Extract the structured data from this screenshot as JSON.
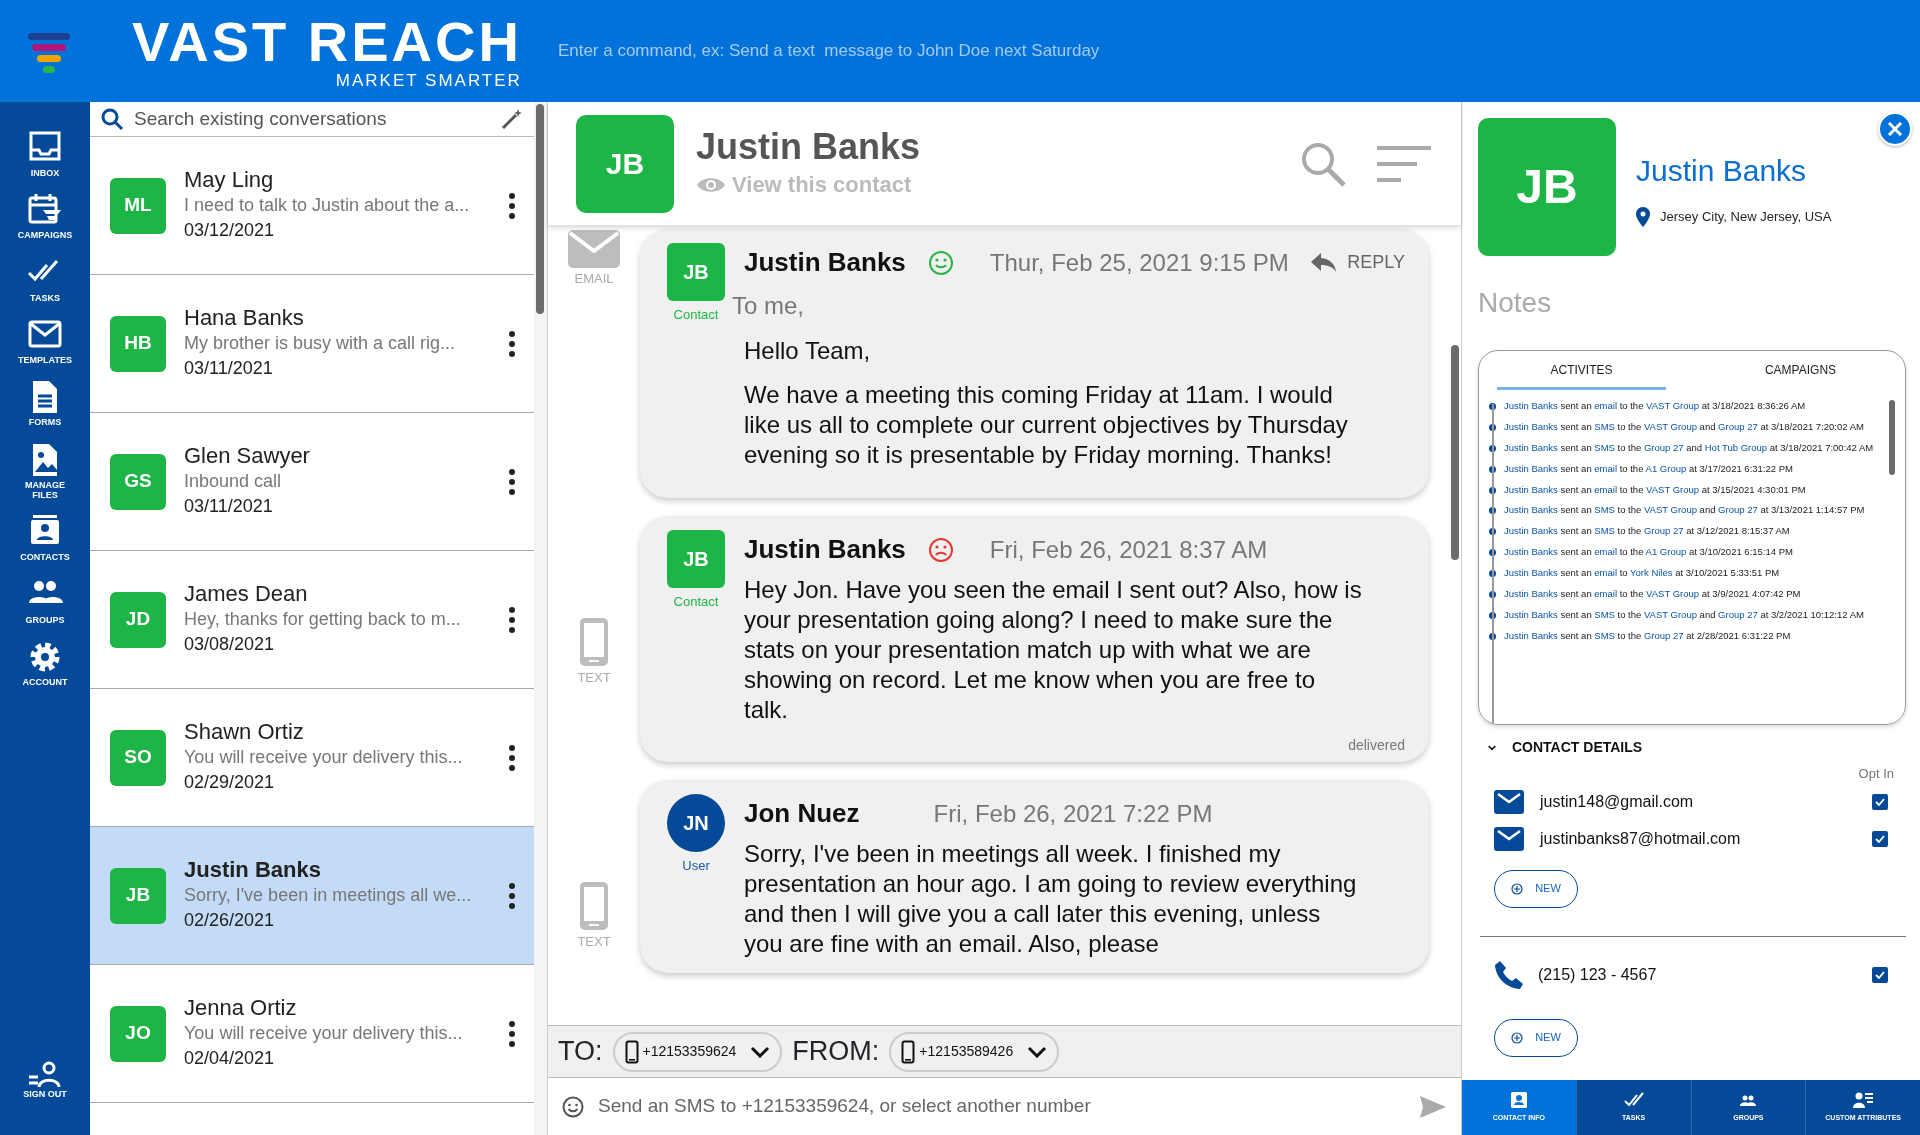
{
  "header": {
    "brand": "VAST REACH",
    "tagline": "MARKET SMARTER",
    "command_placeholder": "Enter a command, ex: Send a text  message to John Doe next Saturday"
  },
  "nav": {
    "items": [
      {
        "label": "INBOX"
      },
      {
        "label": "CAMPAIGNS"
      },
      {
        "label": "TASKS"
      },
      {
        "label": "TEMPLATES"
      },
      {
        "label": "FORMS"
      },
      {
        "label": "MANAGE FILES"
      },
      {
        "label": "CONTACTS"
      },
      {
        "label": "GROUPS"
      },
      {
        "label": "ACCOUNT"
      }
    ],
    "sign_out": "SIGN OUT"
  },
  "conversation_search": {
    "placeholder": "Search existing conversations"
  },
  "conversations": [
    {
      "initials": "ML",
      "name": "May Ling",
      "preview": "I need to talk to Justin about the a...",
      "date": "03/12/2021",
      "selected": false
    },
    {
      "initials": "HB",
      "name": "Hana Banks",
      "preview": "My brother is busy with a call rig...",
      "date": "03/11/2021",
      "selected": false
    },
    {
      "initials": "GS",
      "name": "Glen Sawyer",
      "preview": "Inbound call",
      "date": "03/11/2021",
      "selected": false
    },
    {
      "initials": "JD",
      "name": "James Dean",
      "preview": "Hey, thanks for getting back to m...",
      "date": "03/08/2021",
      "selected": false
    },
    {
      "initials": "SO",
      "name": "Shawn Ortiz",
      "preview": "You will receive your delivery this...",
      "date": "02/29/2021",
      "selected": false
    },
    {
      "initials": "JB",
      "name": "Justin Banks",
      "preview": "Sorry, I've been in meetings all we...",
      "date": "02/26/2021",
      "selected": true
    },
    {
      "initials": "JO",
      "name": "Jenna Ortiz",
      "preview": "You will receive your delivery this...",
      "date": "02/04/2021",
      "selected": false
    }
  ],
  "conversation": {
    "initials": "JB",
    "name": "Justin Banks",
    "view_link": "View this contact"
  },
  "messages": [
    {
      "kind": "email",
      "channel_label": "EMAIL",
      "avatar": {
        "kind": "contact",
        "initials": "JB",
        "role": "Contact"
      },
      "sender": "Justin Banks",
      "sentiment": {
        "kind": "positive"
      },
      "time": "Thur, Feb 25, 2021 9:15 PM",
      "reply": "REPLY",
      "recipient": "To me,",
      "body": [
        "Hello Team,",
        "We have a meeting this coming Friday at 11am. I would like us all to complete our current objectives by Thursday evening so it is presentable by Friday morning. Thanks!"
      ]
    },
    {
      "kind": "text",
      "channel_label": "TEXT",
      "avatar": {
        "kind": "contact",
        "initials": "JB",
        "role": "Contact"
      },
      "sender": "Justin Banks",
      "sentiment": {
        "kind": "negative"
      },
      "time": "Fri, Feb 26, 2021 8:37 AM",
      "body": [
        "Hey Jon. Have you seen the email I sent out? Also, how is your presentation going along? I need to make sure the stats on your presentation match up with what we are showing on record. Let me know when you are free to talk."
      ],
      "status": "delivered"
    },
    {
      "kind": "text",
      "channel_label": "TEXT",
      "avatar": {
        "kind": "user",
        "initials": "JN",
        "role": "User"
      },
      "sender": "Jon Nuez",
      "time": "Fri, Feb 26, 2021 7:22 PM",
      "body": [
        "Sorry, I've been in meetings all week. I finished my presentation an hour ago. I am going to review everything and then I will give you a call later this evening, unless you are fine with an email. Also, please"
      ]
    }
  ],
  "compose": {
    "to_label": "TO:",
    "to_number": "+12153359624",
    "from_label": "FROM:",
    "from_number": "+12153589426",
    "placeholder": "Send an SMS to +12153359624, or select another number"
  },
  "contact": {
    "initials": "JB",
    "name": "Justin Banks",
    "location": "Jersey City, New Jersey, USA",
    "notes_label": "Notes",
    "tabs": [
      {
        "label": "ACTIVITES",
        "selected": true
      },
      {
        "label": "CAMPAIGNS",
        "selected": false
      }
    ],
    "activities": [
      [
        {
          "text": "Justin Banks",
          "link": true
        },
        {
          "text": "sent an",
          "link": false
        },
        {
          "text": "email",
          "link": true
        },
        {
          "text": "to the",
          "link": false
        },
        {
          "text": "VAST Group",
          "link": true
        },
        {
          "text": "at 3/18/2021 8:36:26 AM",
          "link": false
        }
      ],
      [
        {
          "text": "Justin Banks",
          "link": true
        },
        {
          "text": "sent an",
          "link": false
        },
        {
          "text": "SMS",
          "link": true
        },
        {
          "text": "to the",
          "link": false
        },
        {
          "text": "VAST Group",
          "link": true
        },
        {
          "text": "and",
          "link": false
        },
        {
          "text": "Group 27",
          "link": true
        },
        {
          "text": "at 3/18/2021 7:20:02 AM",
          "link": false
        }
      ],
      [
        {
          "text": "Justin Banks",
          "link": true
        },
        {
          "text": "sent an",
          "link": false
        },
        {
          "text": "SMS",
          "link": true
        },
        {
          "text": "to the",
          "link": false
        },
        {
          "text": "Group 27",
          "link": true
        },
        {
          "text": "and",
          "link": false
        },
        {
          "text": "Hot Tub Group",
          "link": true
        },
        {
          "text": "at 3/18/2021 7:00:42 AM",
          "link": false
        }
      ],
      [
        {
          "text": "Justin Banks",
          "link": true
        },
        {
          "text": "sent an",
          "link": false
        },
        {
          "text": "email",
          "link": true
        },
        {
          "text": "to the",
          "link": false
        },
        {
          "text": "A1 Group",
          "link": true
        },
        {
          "text": "at 3/17/2021 6:31:22 PM",
          "link": false
        }
      ],
      [
        {
          "text": "Justin Banks",
          "link": true
        },
        {
          "text": "sent an",
          "link": false
        },
        {
          "text": "email",
          "link": true
        },
        {
          "text": "to the",
          "link": false
        },
        {
          "text": "VAST Group",
          "link": true
        },
        {
          "text": "at 3/15/2021 4:30:01 PM",
          "link": false
        }
      ],
      [
        {
          "text": "Justin Banks",
          "link": true
        },
        {
          "text": "sent an",
          "link": false
        },
        {
          "text": "SMS",
          "link": true
        },
        {
          "text": "to the",
          "link": false
        },
        {
          "text": "VAST Group",
          "link": true
        },
        {
          "text": "and",
          "link": false
        },
        {
          "text": "Group 27",
          "link": true
        },
        {
          "text": "at 3/13/2021 1:14:57 PM",
          "link": false
        }
      ],
      [
        {
          "text": "Justin Banks",
          "link": true
        },
        {
          "text": "sent an",
          "link": false
        },
        {
          "text": "SMS",
          "link": true
        },
        {
          "text": "to the",
          "link": false
        },
        {
          "text": "Group 27",
          "link": true
        },
        {
          "text": "at 3/12/2021 8:15:37 AM",
          "link": false
        }
      ],
      [
        {
          "text": "Justin Banks",
          "link": true
        },
        {
          "text": "sent an",
          "link": false
        },
        {
          "text": "email",
          "link": true
        },
        {
          "text": "to the",
          "link": false
        },
        {
          "text": "A1 Group",
          "link": true
        },
        {
          "text": "at 3/10/2021 6:15:14 PM",
          "link": false
        }
      ],
      [
        {
          "text": "Justin Banks",
          "link": true
        },
        {
          "text": "sent an",
          "link": false
        },
        {
          "text": "email",
          "link": true
        },
        {
          "text": "to",
          "link": false
        },
        {
          "text": "York Niles",
          "link": true
        },
        {
          "text": "at 3/10/2021 5:33:51 PM",
          "link": false
        }
      ],
      [
        {
          "text": "Justin Banks",
          "link": true
        },
        {
          "text": "sent an",
          "link": false
        },
        {
          "text": "email",
          "link": true
        },
        {
          "text": "to the",
          "link": false
        },
        {
          "text": "VAST Group",
          "link": true
        },
        {
          "text": "at 3/9/2021 4:07:42 PM",
          "link": false
        }
      ],
      [
        {
          "text": "Justin Banks",
          "link": true
        },
        {
          "text": "sent an",
          "link": false
        },
        {
          "text": "SMS",
          "link": true
        },
        {
          "text": "to the",
          "link": false
        },
        {
          "text": "VAST Group",
          "link": true
        },
        {
          "text": "and",
          "link": false
        },
        {
          "text": "Group 27",
          "link": true
        },
        {
          "text": "at 3/2/2021 10:12:12 AM",
          "link": false
        }
      ],
      [
        {
          "text": "Justin Banks",
          "link": true
        },
        {
          "text": "sent an",
          "link": false
        },
        {
          "text": "SMS",
          "link": true
        },
        {
          "text": "to the",
          "link": false
        },
        {
          "text": "Group 27",
          "link": true
        },
        {
          "text": "at 2/28/2021 6:31:22 PM",
          "link": false
        }
      ]
    ],
    "details": {
      "title": "CONTACT DETAILS",
      "expanded": true,
      "opt_in_label": "Opt In",
      "emails": [
        {
          "address": "justin148@gmail.com",
          "opt_in": true
        },
        {
          "address": "justinbanks87@hotmail.com",
          "opt_in": true
        }
      ],
      "email_new": "NEW",
      "phones": [
        {
          "number": "(215) 123 - 4567",
          "opt_in": true
        }
      ],
      "phone_new": "NEW"
    }
  },
  "bottom_tabs": [
    {
      "label": "CONTACT INFO",
      "selected": true
    },
    {
      "label": "TASKS",
      "selected": false
    },
    {
      "label": "GROUPS",
      "selected": false
    },
    {
      "label": "CUSTOM ATTRIBUTES",
      "selected": false
    }
  ]
}
